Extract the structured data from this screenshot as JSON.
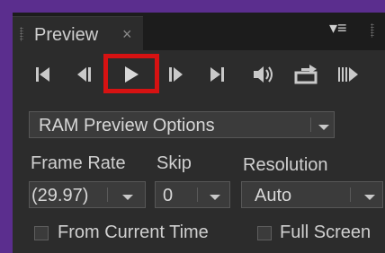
{
  "panel": {
    "tab_title": "Preview",
    "tab_close": "×",
    "menu_icon": "≡"
  },
  "transport": {
    "buttons": [
      {
        "name": "first-frame"
      },
      {
        "name": "previous-frame"
      },
      {
        "name": "play"
      },
      {
        "name": "next-frame"
      },
      {
        "name": "last-frame"
      },
      {
        "name": "mute-audio"
      },
      {
        "name": "loop"
      },
      {
        "name": "ram-preview"
      }
    ]
  },
  "ram_preview": {
    "selected": "RAM Preview Options"
  },
  "labels": {
    "frame_rate": "Frame Rate",
    "skip": "Skip",
    "resolution": "Resolution"
  },
  "fields": {
    "frame_rate_value": "(29.97)",
    "skip_value": "0",
    "resolution_value": "Auto"
  },
  "options": {
    "from_current_time": "From Current Time",
    "full_screen": "Full Screen"
  },
  "colors": {
    "highlight": "#d61212",
    "panel_bg": "#2c2c2c",
    "border_purple": "#5b2e8e"
  }
}
